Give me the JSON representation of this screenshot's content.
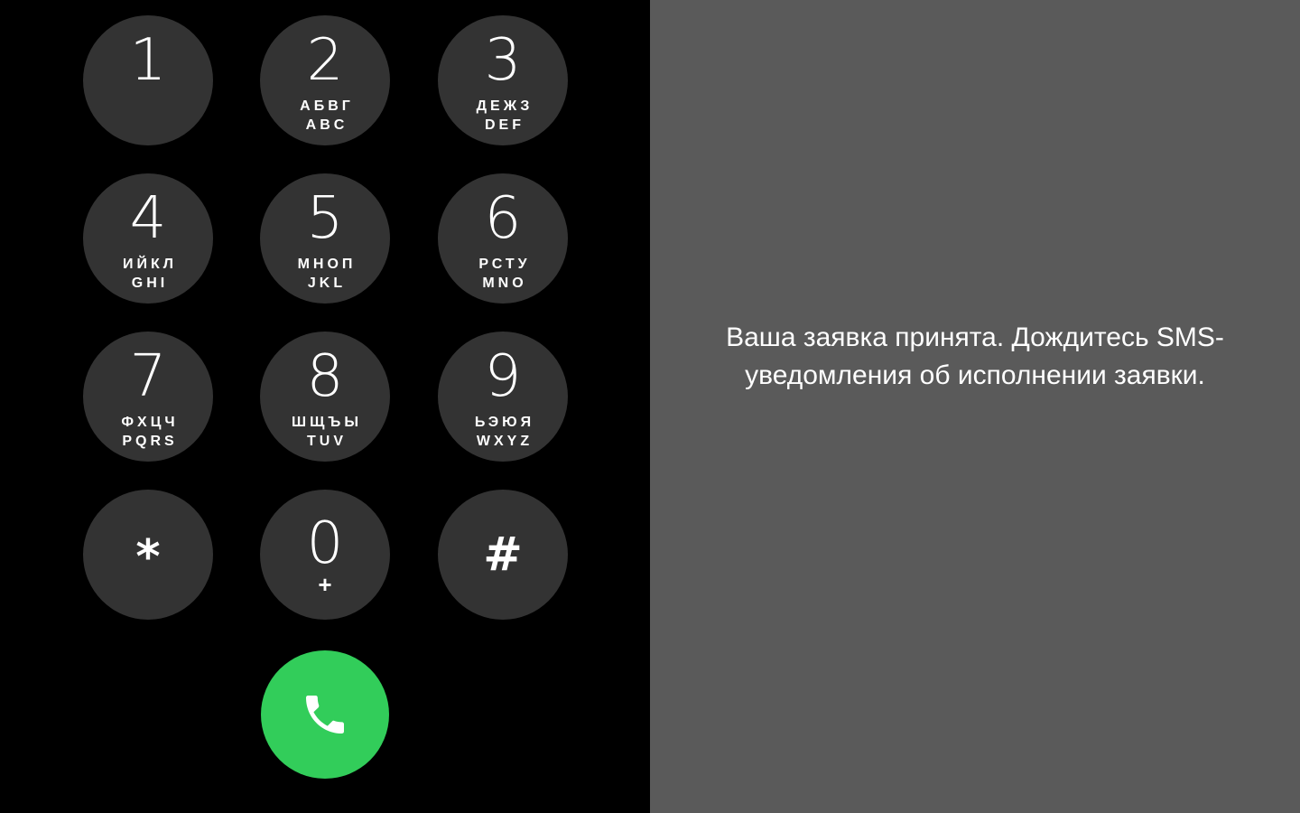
{
  "dialer": {
    "keys": [
      {
        "digit": "1",
        "letters_ru": "",
        "letters_en": ""
      },
      {
        "digit": "2",
        "letters_ru": "АБВГ",
        "letters_en": "ABC"
      },
      {
        "digit": "3",
        "letters_ru": "ДЕЖЗ",
        "letters_en": "DEF"
      },
      {
        "digit": "4",
        "letters_ru": "ИЙКЛ",
        "letters_en": "GHI"
      },
      {
        "digit": "5",
        "letters_ru": "МНОП",
        "letters_en": "JKL"
      },
      {
        "digit": "6",
        "letters_ru": "РСТУ",
        "letters_en": "MNO"
      },
      {
        "digit": "7",
        "letters_ru": "ФХЦЧ",
        "letters_en": "PQRS"
      },
      {
        "digit": "8",
        "letters_ru": "ШЩЪЫ",
        "letters_en": "TUV"
      },
      {
        "digit": "9",
        "letters_ru": "ЬЭЮЯ",
        "letters_en": "WXYZ"
      },
      {
        "digit": "*"
      },
      {
        "digit": "0",
        "sub": "+"
      },
      {
        "digit": "#"
      }
    ],
    "call_button_icon": "phone-icon",
    "colors": {
      "background": "#000000",
      "key": "#333333",
      "call": "#32cd5a"
    }
  },
  "message": {
    "line1": "Ваша заявка принята. Дождитесь SMS-",
    "line2": "уведомления об исполнении заявки.",
    "background": "#5a5a5a"
  }
}
